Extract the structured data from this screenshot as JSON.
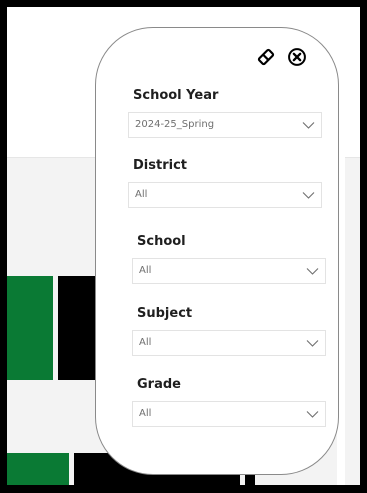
{
  "colors": {
    "frame": "#000000",
    "report_background": "#ffffff",
    "lower_area": "#f3f3f3",
    "bar_green": "#0a7a34",
    "bar_black": "#000000",
    "panel_border": "#8a8a8a",
    "label_text": "#1f1f1f",
    "value_text": "#6f6f6f"
  },
  "panel": {
    "icons": {
      "clear_filters": "eraser-icon",
      "close": "close-icon"
    },
    "filters": [
      {
        "label": "School Year",
        "value": "2024-25_Spring",
        "icon": "chevron-down-icon"
      },
      {
        "label": "District",
        "value": "All",
        "icon": "chevron-down-icon"
      },
      {
        "label": "School",
        "value": "All",
        "icon": "chevron-down-icon"
      },
      {
        "label": "Subject",
        "value": "All",
        "icon": "chevron-down-icon"
      },
      {
        "label": "Grade",
        "value": "All",
        "icon": "chevron-down-icon"
      }
    ]
  }
}
